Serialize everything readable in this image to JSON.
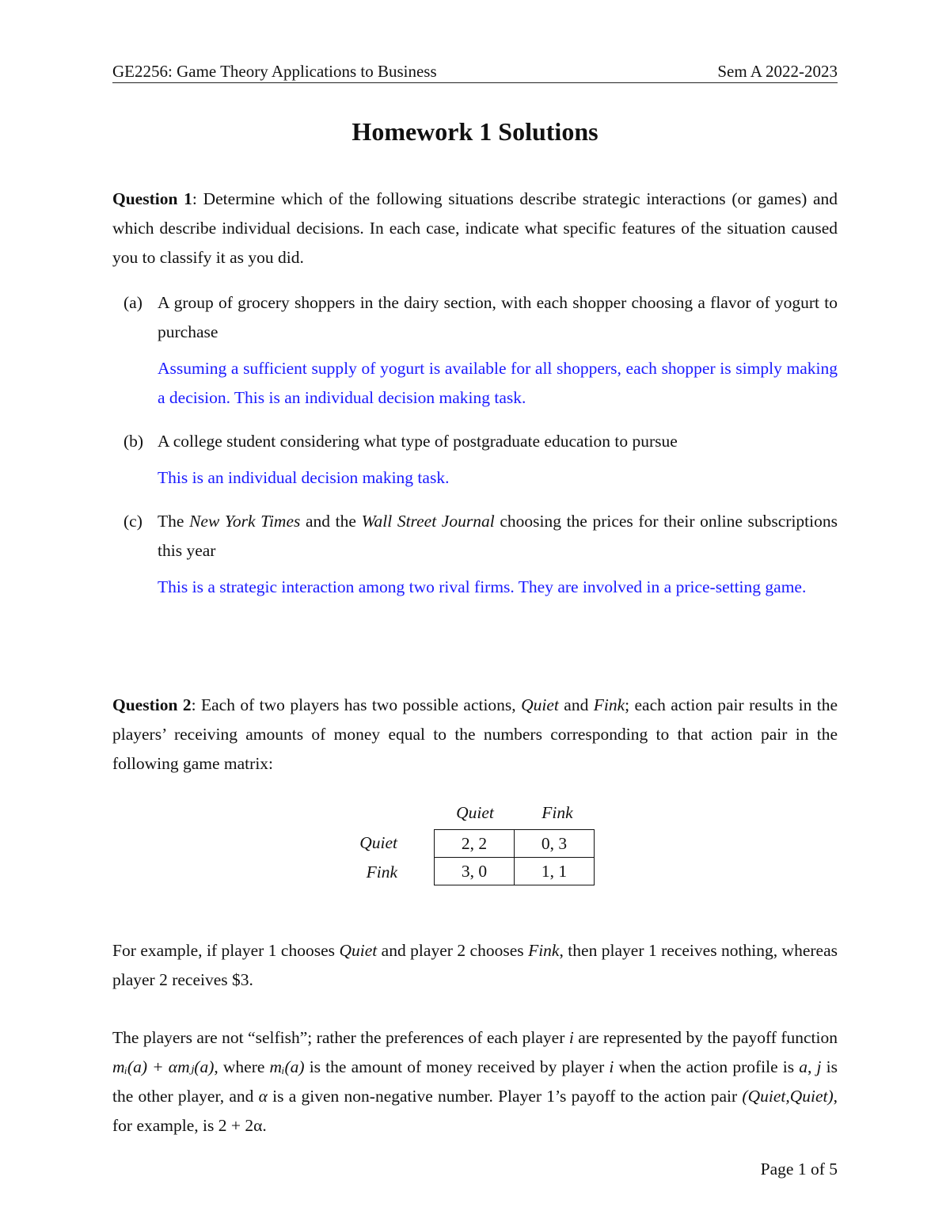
{
  "header": {
    "course": "GE2256: Game Theory Applications to Business",
    "semester": "Sem A 2022-2023"
  },
  "title": "Homework 1 Solutions",
  "q1": {
    "label": "Question 1",
    "text": ": Determine which of the following situations describe strategic interactions (or games) and which describe individual decisions. In each case, indicate what specific features of the situation caused you to classify it as you did.",
    "items": [
      {
        "label": "(a)",
        "question": "A group of grocery shoppers in the dairy section, with each shopper choosing a flavor of yogurt to purchase",
        "answer": "Assuming a sufficient supply of yogurt is available for all shoppers, each shopper is simply making a decision. This is an individual decision making task."
      },
      {
        "label": "(b)",
        "question": "A college student considering what type of postgraduate education to pursue",
        "answer": "This is an individual decision making task."
      },
      {
        "label": "(c)",
        "question_pre": "The ",
        "question_em1": "New York Times",
        "question_mid": " and the ",
        "question_em2": "Wall Street Journal",
        "question_post": " choosing the prices for their online subscriptions this year",
        "answer": "This is a strategic interaction among two rival firms.  They are involved in a price-setting game."
      }
    ]
  },
  "q2": {
    "label": "Question 2",
    "text_pre": ": Each of two players has two possible actions, ",
    "em_quiet": "Quiet",
    "text_and": " and ",
    "em_fink": "Fink",
    "text_post": "; each action pair results in the players’ receiving amounts of money equal to the numbers corresponding to that action pair in the following game matrix:",
    "matrix": {
      "col_headers": [
        "Quiet",
        "Fink"
      ],
      "row_headers": [
        "Quiet",
        "Fink"
      ],
      "cells": [
        [
          "2, 2",
          "0, 3"
        ],
        [
          "3, 0",
          "1, 1"
        ]
      ]
    },
    "example": {
      "pre": "For example, if player 1 chooses ",
      "em1": "Quiet",
      "mid": " and player 2 chooses ",
      "em2": "Fink",
      "post": ", then player 1 receives nothing, whereas player 2 receives $3."
    },
    "pref": {
      "p1": "The players are not “selfish”; rather the preferences of each player ",
      "i1": "i",
      "p2": " are represented by the payoff function ",
      "f1": "mᵢ(a) + αmⱼ(a)",
      "p3": ", where ",
      "f2": "mᵢ(a)",
      "p4": " is the amount of money received by player ",
      "i2": "i",
      "p5": " when the action profile is ",
      "a": "a",
      "p6": ", ",
      "j": "j",
      "p7": " is the other player, and ",
      "alpha": "α",
      "p8": " is a given non-negative number. Player 1’s payoff to the action pair ",
      "pair": "(Quiet,Quiet)",
      "p9": ", for example, is ",
      "f3": "2 + 2α",
      "p10": "."
    }
  },
  "footer": {
    "page": "Page 1 of 5"
  }
}
